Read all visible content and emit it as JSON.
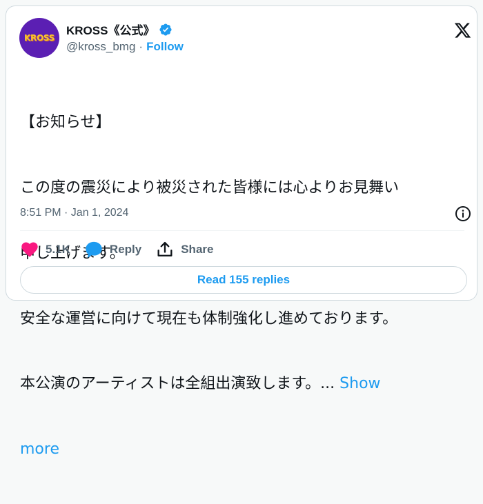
{
  "author": {
    "display_name": "KROSS《公式》",
    "handle": "@kross_bmg",
    "separator": "·",
    "follow_label": "Follow",
    "avatar_text": "KROSS",
    "verified": true
  },
  "tweet": {
    "lines": [
      "【お知らせ】",
      "この度の震災により被災された皆様には心よりお見舞い",
      "申し上げます。",
      "安全な運営に向けて現在も体制強化し進めております。",
      "本公演のアーティストは全組出演致します。..."
    ],
    "show_more_label_1": "Show",
    "show_more_label_2": "more",
    "timestamp": "8:51 PM · Jan 1, 2024"
  },
  "actions": {
    "like_count": "5.1K",
    "reply_label": "Reply",
    "share_label": "Share"
  },
  "read_replies_label": "Read 155 replies",
  "colors": {
    "accent": "#1d9bf0",
    "like": "#f91880",
    "muted": "#536471",
    "avatar_bg": "#5b1fb3"
  },
  "icons": [
    "verified-badge-icon",
    "x-logo-icon",
    "info-icon",
    "heart-icon",
    "reply-bubble-icon",
    "share-icon"
  ]
}
